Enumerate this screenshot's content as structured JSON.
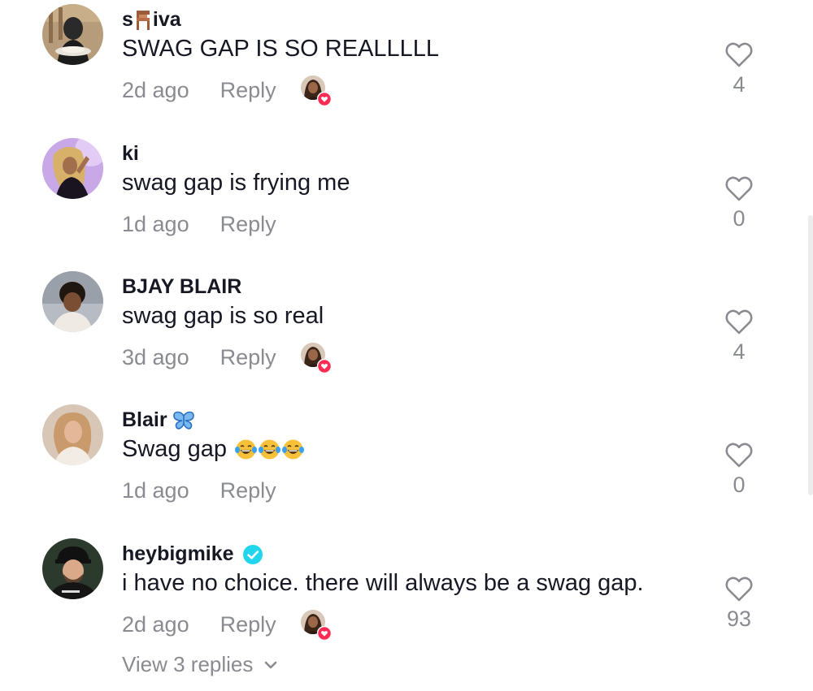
{
  "comments": [
    {
      "username_pre": "s",
      "username_post": "iva",
      "text": "SWAG GAP IS SO REALLLLL",
      "time": "2d ago",
      "reply_label": "Reply",
      "likes": "4",
      "creator_liked": true
    },
    {
      "username": "ki",
      "text": "swag gap is frying me",
      "time": "1d ago",
      "reply_label": "Reply",
      "likes": "0",
      "creator_liked": false
    },
    {
      "username": "BJAY BLAIR",
      "text": "swag gap is so real",
      "time": "3d ago",
      "reply_label": "Reply",
      "likes": "4",
      "creator_liked": true
    },
    {
      "username": "Blair",
      "text": "Swag gap",
      "emoji": "laughing-tears x3",
      "time": "1d ago",
      "reply_label": "Reply",
      "likes": "0",
      "creator_liked": false
    },
    {
      "username": "heybigmike",
      "verified": true,
      "text": "i have no choice. there will always be a swag gap.",
      "time": "2d ago",
      "reply_label": "Reply",
      "likes": "93",
      "creator_liked": true
    }
  ],
  "view_replies": "View 3 replies",
  "colors": {
    "text": "#161823",
    "secondary": "#8a8b91",
    "heart_red": "#fe2c55",
    "verified": "#20d5ec"
  }
}
